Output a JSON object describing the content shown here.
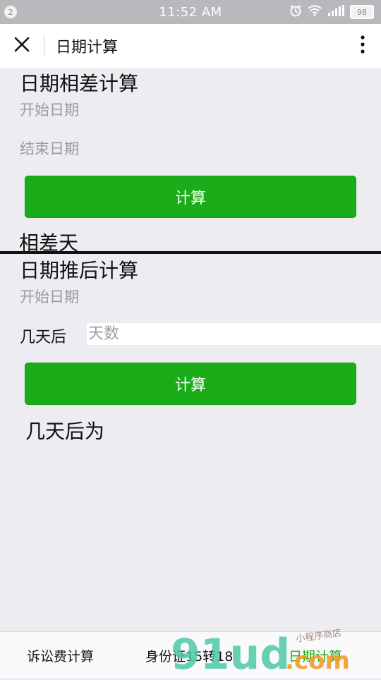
{
  "statusbar": {
    "notification_count": "2",
    "time": "11:52 AM",
    "battery": "98"
  },
  "titlebar": {
    "title": "日期计算"
  },
  "diff_section": {
    "title": "日期相差计算",
    "start_date_label": "开始日期",
    "end_date_label": "结束日期",
    "calc_button": "计算",
    "result_label": "相差天"
  },
  "forward_section": {
    "title": "日期推后计算",
    "start_date_label": "开始日期",
    "days_label": "几天后",
    "days_placeholder": "天数",
    "calc_button": "计算",
    "result_label": "几天后为"
  },
  "tabbar": {
    "tabs": [
      {
        "label": "诉讼费计算",
        "active": false
      },
      {
        "label": "身份证15转18",
        "active": false
      },
      {
        "label": "日期计算",
        "active": true
      }
    ],
    "active_color": "#1aad19"
  },
  "watermark": {
    "text": "91ud.com",
    "tagline": "小程序商店"
  },
  "colors": {
    "primary_green": "#1aad19",
    "background": "#ececf1"
  }
}
